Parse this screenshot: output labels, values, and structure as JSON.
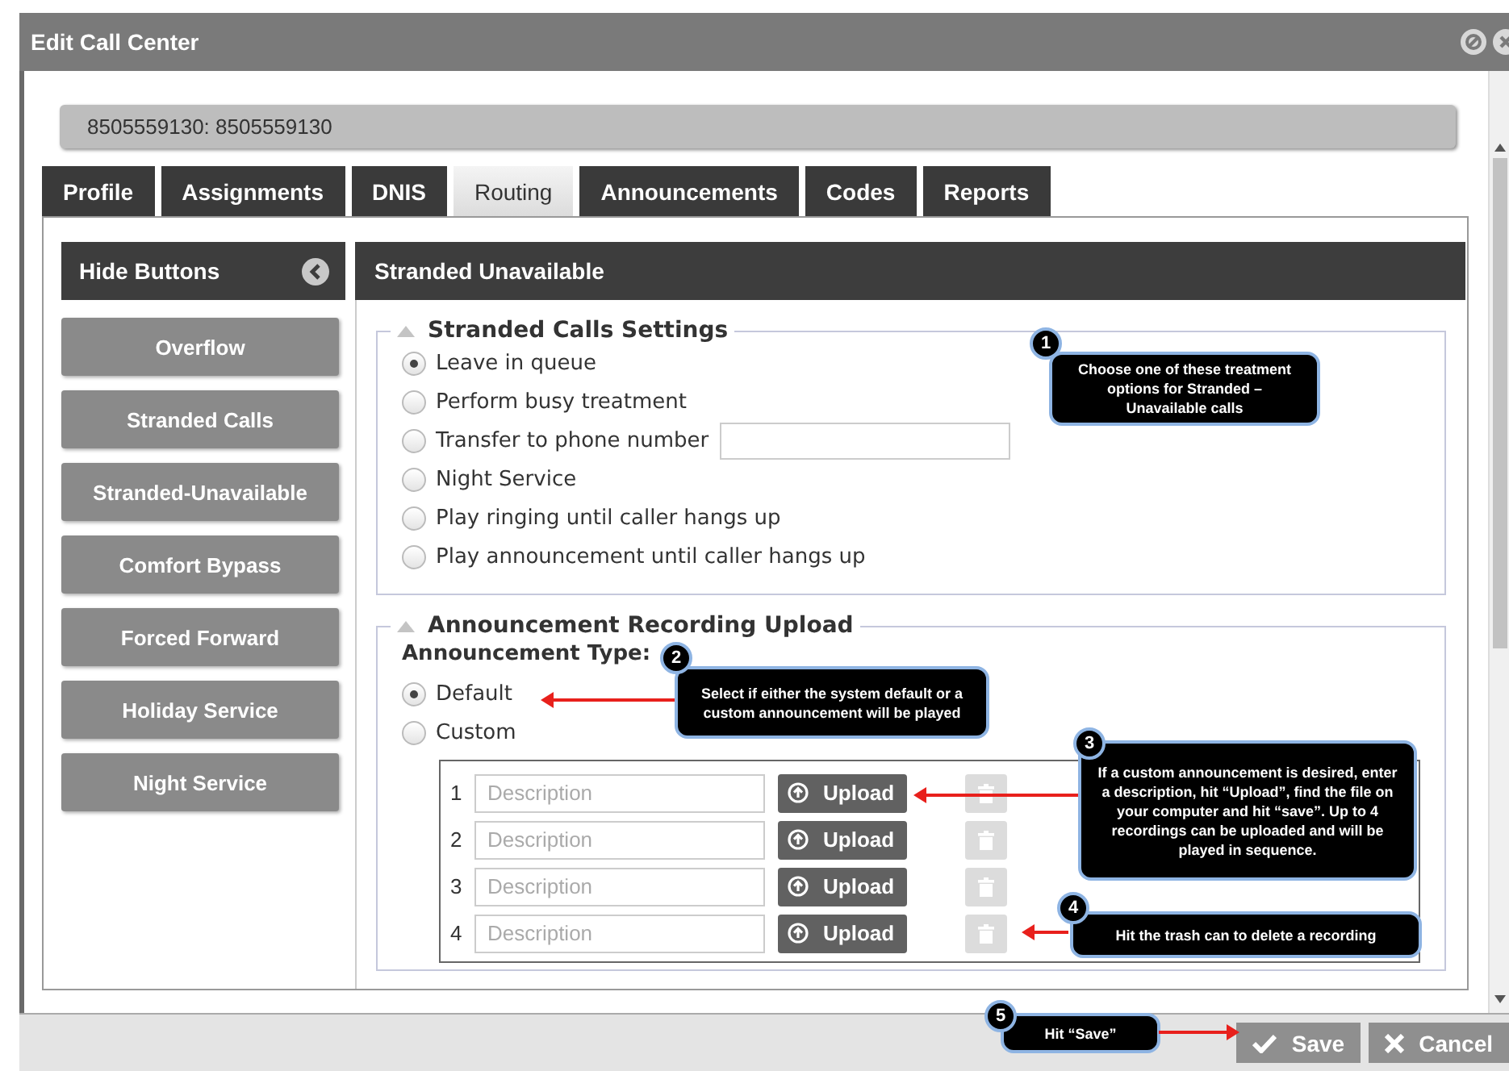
{
  "window": {
    "title": "Edit Call Center"
  },
  "record": {
    "value": "8505559130: 8505559130"
  },
  "tabs": [
    {
      "label": "Profile",
      "selected": false
    },
    {
      "label": "Assignments",
      "selected": false
    },
    {
      "label": "DNIS",
      "selected": false
    },
    {
      "label": "Routing",
      "selected": true
    },
    {
      "label": "Announcements",
      "selected": false
    },
    {
      "label": "Codes",
      "selected": false
    },
    {
      "label": "Reports",
      "selected": false
    }
  ],
  "sidebar": {
    "header": "Hide Buttons",
    "buttons": [
      "Overflow",
      "Stranded Calls",
      "Stranded-Unavailable",
      "Comfort Bypass",
      "Forced Forward",
      "Holiday Service",
      "Night Service"
    ]
  },
  "panel": {
    "title": "Stranded Unavailable",
    "settings": {
      "legend": "Stranded Calls Settings",
      "options": [
        {
          "label": "Leave in queue",
          "selected": true
        },
        {
          "label": "Perform busy treatment",
          "selected": false
        },
        {
          "label": "Transfer to phone number",
          "selected": false,
          "kind": "field"
        },
        {
          "label": "Night Service",
          "selected": false
        },
        {
          "label": "Play ringing until caller hangs up",
          "selected": false
        },
        {
          "label": "Play announcement until caller hangs up",
          "selected": false
        }
      ]
    },
    "upload": {
      "legend": "Announcement Recording Upload",
      "type_label": "Announcement Type:",
      "options": [
        {
          "label": "Default",
          "selected": true
        },
        {
          "label": "Custom",
          "selected": false
        }
      ],
      "rows": [
        {
          "number": "1",
          "placeholder": "Description",
          "button": "Upload"
        },
        {
          "number": "2",
          "placeholder": "Description",
          "button": "Upload"
        },
        {
          "number": "3",
          "placeholder": "Description",
          "button": "Upload"
        },
        {
          "number": "4",
          "placeholder": "Description",
          "button": "Upload"
        }
      ]
    }
  },
  "footer": {
    "buttons": [
      {
        "label": "Save",
        "kind": "save"
      },
      {
        "label": "Cancel",
        "kind": "cancel"
      }
    ]
  },
  "callouts": [
    {
      "number": "1",
      "text": "Choose one of these treatment options for Stranded – Unavailable calls"
    },
    {
      "number": "2",
      "text": "Select if either the system default or a custom announcement will be played"
    },
    {
      "number": "3",
      "text": "If a custom announcement is desired, enter a description, hit “Upload”, find the file on your computer and hit “save”. Up to 4 recordings can be uploaded and will be played in sequence."
    },
    {
      "number": "4",
      "text": "Hit the trash can to delete a recording"
    },
    {
      "number": "5",
      "text": "Hit “Save”"
    }
  ]
}
